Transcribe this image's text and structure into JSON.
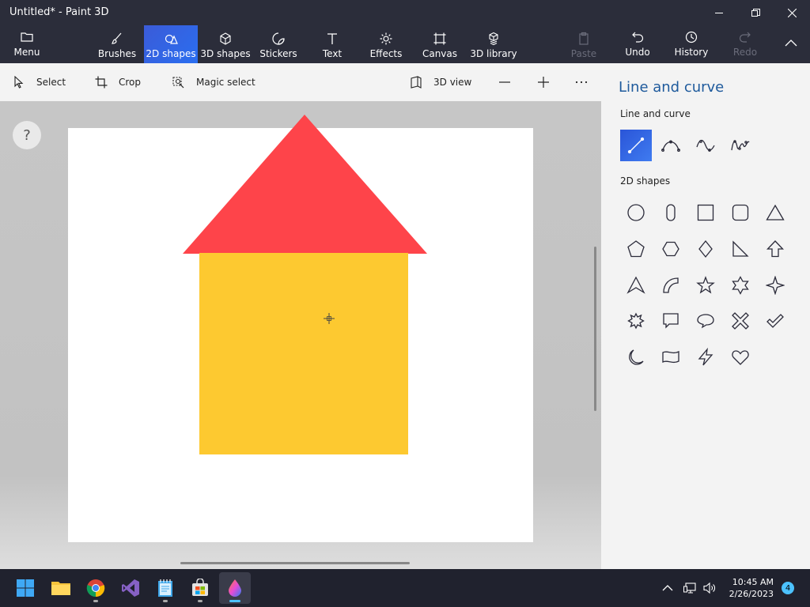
{
  "window": {
    "title": "Untitled* - Paint 3D",
    "controls": [
      "minimize",
      "restore",
      "close"
    ]
  },
  "toolbar": {
    "menu_label": "Menu",
    "items": [
      {
        "label": "Brushes",
        "icon": "brush-icon"
      },
      {
        "label": "2D shapes",
        "icon": "2d-shapes-icon",
        "active": true
      },
      {
        "label": "3D shapes",
        "icon": "cube-icon"
      },
      {
        "label": "Stickers",
        "icon": "sticker-icon"
      },
      {
        "label": "Text",
        "icon": "text-icon"
      },
      {
        "label": "Effects",
        "icon": "sun-icon"
      },
      {
        "label": "Canvas",
        "icon": "canvas-icon"
      },
      {
        "label": "3D library",
        "icon": "library-icon"
      }
    ],
    "paste_label": "Paste",
    "undo_label": "Undo",
    "history_label": "History",
    "redo_label": "Redo"
  },
  "subbar": {
    "select_label": "Select",
    "crop_label": "Crop",
    "magic_select_label": "Magic select",
    "view_3d_label": "3D view"
  },
  "workspace": {
    "help_label": "?",
    "shapes": [
      {
        "type": "triangle",
        "color": "#fe444a"
      },
      {
        "type": "rectangle",
        "color": "#fdc930"
      }
    ]
  },
  "panel": {
    "title": "Line and curve",
    "line_section_label": "Line and curve",
    "shapes_section_label": "2D shapes",
    "line_tools": [
      "line-icon",
      "curve-icon",
      "two-point-curve-icon",
      "three-point-curve-icon"
    ],
    "selected_line_tool": "line-icon",
    "shapes": [
      "circle-icon",
      "pill-icon",
      "square-icon",
      "rounded-square-icon",
      "triangle-icon",
      "pentagon-icon",
      "hexagon-icon",
      "diamond-icon",
      "right-triangle-icon",
      "arrow-up-icon",
      "arrowhead-icon",
      "quarter-circle-icon",
      "star-5-icon",
      "star-6-icon",
      "star-4-icon",
      "burst-icon",
      "speech-bubble-square-icon",
      "speech-bubble-round-icon",
      "x-icon",
      "checkmark-icon",
      "crescent-icon",
      "banner-icon",
      "lightning-icon",
      "heart-icon"
    ]
  },
  "taskbar": {
    "apps": [
      "start-icon",
      "file-explorer-icon",
      "chrome-icon",
      "visual-studio-icon",
      "notepad-icon",
      "store-icon",
      "paint-3d-icon"
    ],
    "time": "10:45 AM",
    "date": "2/26/2023",
    "notification_count": "4"
  },
  "colors": {
    "accent": "#2a6ef0",
    "chrome_bg": "#2b2d3a",
    "panel_bg": "#f3f3f3",
    "panel_title": "#1e5a9c"
  }
}
